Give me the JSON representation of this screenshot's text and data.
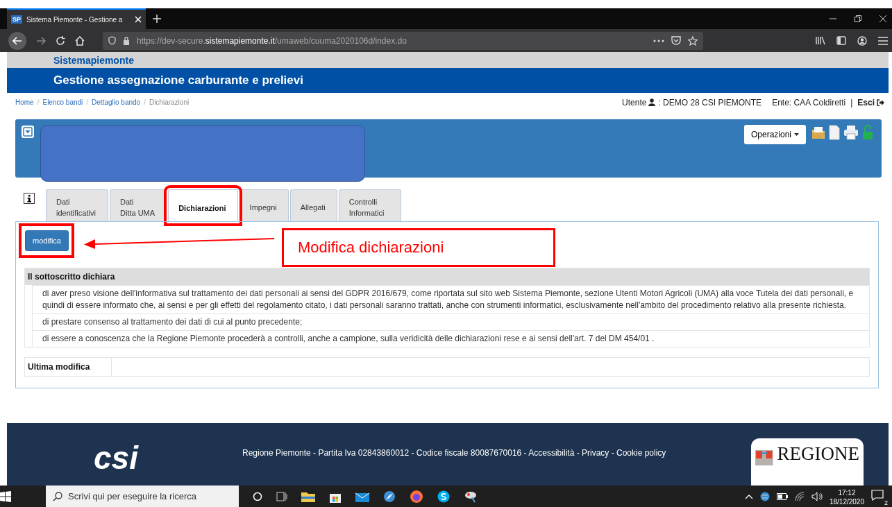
{
  "browser": {
    "tab_title": "Sistema Piemonte - Gestione a",
    "favicon": "SP",
    "url": "https://dev-secure.**sistemapiemonte.it**/umaweb/cuuma2020106d/index.do"
  },
  "header": {
    "brand": "Sistemapiemonte",
    "title": "Gestione assegnazione carburante e prelievi"
  },
  "breadcrumb": [
    {
      "label": "Home",
      "current": false
    },
    {
      "separator_before": "/",
      "label": "Elenco bandi",
      "current": false
    },
    {
      "separator_before": "/",
      "label": "Dettaglio bando",
      "current": false
    },
    {
      "separator_before": "/",
      "label": "Dichiarazioni",
      "current": true
    }
  ],
  "user_bar": {
    "user_label": "Utente",
    "user": ": DEMO 28 CSI PIEMONTE",
    "ente": "Ente: CAA Coldiretti",
    "separator": "|",
    "logout": "Esci"
  },
  "panel": {
    "operations_button": "Operazioni"
  },
  "tabs": [
    {
      "label": "Dati identificativi",
      "selected": false,
      "highlighted": false
    },
    {
      "label": "Dati\nDitta UMA",
      "selected": false,
      "highlighted": false
    },
    {
      "label": "Dichiarazioni",
      "selected": true,
      "highlighted": true
    },
    {
      "label": "Impegni",
      "selected": false,
      "highlighted": false
    },
    {
      "label": "Allegati",
      "selected": false,
      "highlighted": false
    },
    {
      "label": "Controlli Informatici",
      "selected": false,
      "highlighted": false
    }
  ],
  "edit_button": {
    "label": "modifica",
    "highlighted": true
  },
  "callout": {
    "text": "Modifica dichiarazioni"
  },
  "declarations": {
    "heading": "Il sottoscritto dichiara",
    "items": [
      "di aver preso visione dell'informativa sul trattamento dei dati personali ai sensi del GDPR 2016/679, come riportata sul sito web Sistema Piemonte, sezione Utenti Motori Agricoli (UMA) alla voce Tutela dei dati personali, e quindi di essere informato che, ai sensi e per gli effetti del regolamento citato, i dati personali saranno trattati, anche con strumenti informatici, esclusivamente nell'ambito del procedimento relativo alla presente richiesta.",
      "di prestare consenso al trattamento dei dati di cui al punto precedente;",
      "di essere a conoscenza che la Regione Piemonte procederà a controlli, anche a campione, sulla veridicità delle dichiarazioni rese e ai sensi dell'art. 7 del DM 454/01 ."
    ]
  },
  "last_modified": {
    "label": "Ultima modifica"
  },
  "footer": {
    "logo": "csi",
    "text": "Regione Piemonte - Partita Iva 02843860012 - Codice fiscale 80087670016 - Accessibilità - Privacy - Cookie policy",
    "region_logo": "REGIONE"
  },
  "taskbar": {
    "search_placeholder": "Scrivi qui per eseguire la ricerca",
    "time": "17:12",
    "date": "18/12/2020",
    "notifications": "2"
  }
}
